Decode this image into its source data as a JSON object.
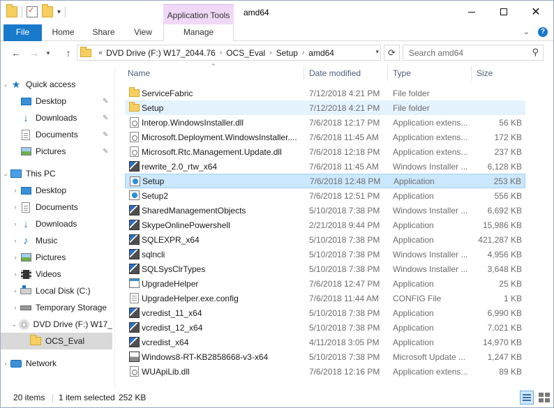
{
  "window": {
    "title": "amd64",
    "contextual_tab_group": "Application Tools"
  },
  "ribbon": {
    "tabs": [
      {
        "label": "File"
      },
      {
        "label": "Home"
      },
      {
        "label": "Share"
      },
      {
        "label": "View"
      },
      {
        "label": "Manage"
      }
    ]
  },
  "address_bar": {
    "overflow": "«",
    "crumbs": [
      "DVD Drive (F:) W17_2044.76",
      "OCS_Eval",
      "Setup",
      "amd64"
    ],
    "search_placeholder": "Search amd64"
  },
  "nav_pane": {
    "items": [
      {
        "label": "Quick access",
        "icon": "star-icon"
      },
      {
        "label": "Desktop",
        "icon": "desktop-icon",
        "pinned": true
      },
      {
        "label": "Downloads",
        "icon": "download-icon",
        "pinned": true
      },
      {
        "label": "Documents",
        "icon": "documents-icon",
        "pinned": true
      },
      {
        "label": "Pictures",
        "icon": "pictures-icon",
        "pinned": true
      },
      {
        "label": "This PC",
        "icon": "computer-icon"
      },
      {
        "label": "Desktop",
        "icon": "desktop-icon"
      },
      {
        "label": "Documents",
        "icon": "documents-icon"
      },
      {
        "label": "Downloads",
        "icon": "download-icon"
      },
      {
        "label": "Music",
        "icon": "music-icon"
      },
      {
        "label": "Pictures",
        "icon": "pictures-icon"
      },
      {
        "label": "Videos",
        "icon": "videos-icon"
      },
      {
        "label": "Local Disk (C:)",
        "icon": "local-disk-icon"
      },
      {
        "label": "Temporary Storage",
        "icon": "drive-icon"
      },
      {
        "label": "DVD Drive (F:) W17_",
        "icon": "dvd-icon"
      },
      {
        "label": "OCS_Eval",
        "icon": "folder-icon"
      },
      {
        "label": "Network",
        "icon": "network-icon"
      }
    ]
  },
  "columns": {
    "name": "Name",
    "date": "Date modified",
    "type": "Type",
    "size": "Size"
  },
  "files": [
    {
      "name": "ServiceFabric",
      "date": "7/12/2018 4:21 PM",
      "type": "File folder",
      "size": "",
      "icon": "folder"
    },
    {
      "name": "Setup",
      "date": "7/12/2018 4:21 PM",
      "type": "File folder",
      "size": "",
      "icon": "folder"
    },
    {
      "name": "Interop.WindowsInstaller.dll",
      "date": "7/6/2018 12:17 PM",
      "type": "Application extens...",
      "size": "56 KB",
      "icon": "dll"
    },
    {
      "name": "Microsoft.Deployment.WindowsInstaller....",
      "date": "7/6/2018 11:45 AM",
      "type": "Application extens...",
      "size": "172 KB",
      "icon": "dll"
    },
    {
      "name": "Microsoft.Rtc.Management.Update.dll",
      "date": "7/6/2018 12:18 PM",
      "type": "Application extens...",
      "size": "237 KB",
      "icon": "dll"
    },
    {
      "name": "rewrite_2.0_rtw_x64",
      "date": "7/6/2018 11:45 AM",
      "type": "Windows Installer ...",
      "size": "6,128 KB",
      "icon": "msi"
    },
    {
      "name": "Setup",
      "date": "7/6/2018 12:48 PM",
      "type": "Application",
      "size": "253 KB",
      "icon": "setup"
    },
    {
      "name": "Setup2",
      "date": "7/6/2018 12:51 PM",
      "type": "Application",
      "size": "556 KB",
      "icon": "setup"
    },
    {
      "name": "SharedManagementObjects",
      "date": "5/10/2018 7:38 PM",
      "type": "Windows Installer ...",
      "size": "6,692 KB",
      "icon": "msi"
    },
    {
      "name": "SkypeOnlinePowershell",
      "date": "2/21/2018 9:44 PM",
      "type": "Application",
      "size": "15,986 KB",
      "icon": "msi"
    },
    {
      "name": "SQLEXPR_x64",
      "date": "5/10/2018 7:38 PM",
      "type": "Application",
      "size": "421,287 KB",
      "icon": "msi"
    },
    {
      "name": "sqlncli",
      "date": "5/10/2018 7:38 PM",
      "type": "Windows Installer ...",
      "size": "4,956 KB",
      "icon": "msi"
    },
    {
      "name": "SQLSysClrTypes",
      "date": "5/10/2018 7:38 PM",
      "type": "Windows Installer ...",
      "size": "3,648 KB",
      "icon": "msi"
    },
    {
      "name": "UpgradeHelper",
      "date": "7/6/2018 12:47 PM",
      "type": "Application",
      "size": "25 KB",
      "icon": "app"
    },
    {
      "name": "UpgradeHelper.exe.config",
      "date": "7/6/2018 11:44 AM",
      "type": "CONFIG File",
      "size": "1 KB",
      "icon": "config"
    },
    {
      "name": "vcredist_11_x64",
      "date": "5/10/2018 7:38 PM",
      "type": "Application",
      "size": "6,990 KB",
      "icon": "msi"
    },
    {
      "name": "vcredist_12_x64",
      "date": "5/10/2018 7:38 PM",
      "type": "Application",
      "size": "7,021 KB",
      "icon": "msi"
    },
    {
      "name": "vcredist_x64",
      "date": "4/11/2018 3:05 PM",
      "type": "Application",
      "size": "14,970 KB",
      "icon": "msi"
    },
    {
      "name": "Windows8-RT-KB2858668-v3-x64",
      "date": "5/10/2018 7:38 PM",
      "type": "Microsoft Update ...",
      "size": "1,247 KB",
      "icon": "update"
    },
    {
      "name": "WUApiLib.dll",
      "date": "7/6/2018 12:16 PM",
      "type": "Application extens...",
      "size": "89 KB",
      "icon": "dll"
    }
  ],
  "status": {
    "count": "20 items",
    "selected": "1 item selected",
    "selected_size": "252 KB"
  }
}
